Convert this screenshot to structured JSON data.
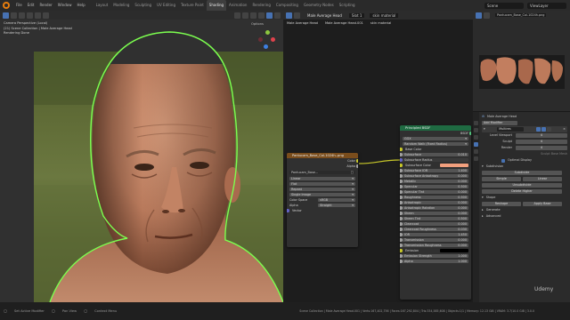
{
  "menu": [
    "File",
    "Edit",
    "Render",
    "Window",
    "Help"
  ],
  "workspaces": [
    "Layout",
    "Modeling",
    "Sculpting",
    "UV Editing",
    "Texture Paint",
    "Shading",
    "Animation",
    "Rendering",
    "Compositing",
    "Geometry Nodes",
    "Scripting"
  ],
  "active_workspace": "Shading",
  "scene": "Scene",
  "view_layer": "ViewLayer",
  "viewport": {
    "overlay_lines": [
      "Camera Perspective (Local)",
      "(21) Scene Collection | Male Average Head",
      "Rendering Done"
    ],
    "options": "Options"
  },
  "node_editor": {
    "object": "Male Average Head",
    "slot": "Slot 1",
    "material": "skin material",
    "breadcrumb": [
      "Male Average Head",
      "Male Average Head.001",
      "skin material"
    ],
    "image_node": {
      "title": "Pantucam_Base_Col-1024h-.png",
      "out_color": "Color",
      "out_alpha": "Alpha",
      "image_name": "Pantucam_Base...",
      "interpolation": "Linear",
      "projection": "Flat",
      "extension": "Repeat",
      "source": "Single Image",
      "color_space_label": "Color Space",
      "color_space": "sRGB",
      "alpha_label": "Alpha",
      "alpha": "Straight",
      "vector": "Vector"
    },
    "bsdf": {
      "title": "Principled BSDF",
      "output": "BSDF",
      "distribution": "GGX",
      "subsurface_method": "Random Walk (Fixed Radius)",
      "rows": [
        {
          "label": "Base Color",
          "kind": "label"
        },
        {
          "label": "Subsurface",
          "value": "0.010"
        },
        {
          "label": "Subsurface Radius",
          "kind": "vector"
        },
        {
          "label": "Subsurface Color",
          "kind": "color",
          "color": "#f2a07e"
        },
        {
          "label": "Subsurface IOR",
          "value": "1.400"
        },
        {
          "label": "Subsurface Anisotropy",
          "value": "0.000"
        },
        {
          "label": "Metallic",
          "value": "0.000"
        },
        {
          "label": "Specular",
          "value": "0.500"
        },
        {
          "label": "Specular Tint",
          "value": "0.000"
        },
        {
          "label": "Roughness",
          "value": "0.500"
        },
        {
          "label": "Anisotropic",
          "value": "0.000"
        },
        {
          "label": "Anisotropic Rotation",
          "value": "0.000"
        },
        {
          "label": "Sheen",
          "value": "0.000"
        },
        {
          "label": "Sheen Tint",
          "value": "0.500"
        },
        {
          "label": "Clearcoat",
          "value": "0.000"
        },
        {
          "label": "Clearcoat Roughness",
          "value": "0.030"
        },
        {
          "label": "IOR",
          "value": "1.450"
        },
        {
          "label": "Transmission",
          "value": "0.000"
        },
        {
          "label": "Transmission Roughness",
          "value": "0.000"
        },
        {
          "label": "Emission",
          "kind": "color",
          "color": "#000000"
        },
        {
          "label": "Emission Strength",
          "value": "1.000"
        },
        {
          "label": "Alpha",
          "value": "1.000"
        }
      ]
    }
  },
  "image_editor": {
    "image": "Pantucam_Base_Col-1024h.png"
  },
  "properties": {
    "object": "Male Average Head",
    "modifier_section": "Add Modifier",
    "modifier_name": "Multires",
    "rows": [
      {
        "label": "Level Viewport",
        "value": "4"
      },
      {
        "label": "Sculpt",
        "value": "4"
      },
      {
        "label": "Render",
        "value": "4"
      }
    ],
    "sculpt_base_mesh": "Sculpt Base Mesh",
    "optimal_display": "Optimal Display",
    "subdivision_section": "Subdivision",
    "subdivide": "Subdivide",
    "simple": "Simple",
    "linear": "Linear",
    "unsubdivide": "Unsubdivide",
    "delete_higher": "Delete Higher",
    "shape_section": "Shape",
    "reshape": "Reshape",
    "apply_base": "Apply Base",
    "generate_section": "Generate",
    "advanced_section": "Advanced"
  },
  "statusbar": {
    "select": "Set Active Modifier",
    "pan": "Pan View",
    "context": "Context Menu",
    "stats": "Scene Collection | Male Average Head.001 | Verts:167,402,756 | Faces:167,292,804 | Tris:334,585,608 | Objects:1/1 | Memory: 12.13 GiB | VRAM: 3.7/10.0 GiB | 3.0.0"
  },
  "watermark": "Udemy"
}
